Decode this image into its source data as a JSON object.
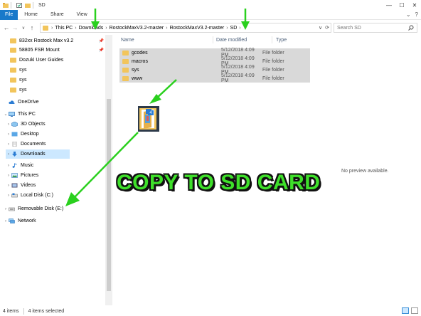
{
  "window": {
    "title": "SD",
    "controls": {
      "minimize": "—",
      "maximize": "☐",
      "close": "✕"
    }
  },
  "ribbon": {
    "tabs": [
      "File",
      "Home",
      "Share",
      "View"
    ],
    "help": "?"
  },
  "nav_buttons": {
    "back": "←",
    "forward": "→",
    "recent": "∨",
    "up": "↑"
  },
  "address": {
    "crumbs": [
      "This PC",
      "Downloads",
      "RostockMaxV3.2-master",
      "RostockMaxV3.2-master",
      "SD"
    ],
    "separator": "›",
    "dropdown": "∨",
    "refresh": "⟳"
  },
  "search": {
    "placeholder": "Search SD",
    "icon": "search-icon"
  },
  "nav_pane": {
    "quick_access": [
      {
        "label": "832xx Rostock Max v3.2",
        "pinned": true
      },
      {
        "label": "58805 FSR Mount",
        "pinned": true
      },
      {
        "label": "Dozuki User Guides",
        "pinned": false
      },
      {
        "label": "sys",
        "pinned": false
      },
      {
        "label": "sys",
        "pinned": false
      },
      {
        "label": "sys",
        "pinned": false
      }
    ],
    "onedrive": "OneDrive",
    "this_pc": "This PC",
    "pc_items": [
      "3D Objects",
      "Desktop",
      "Documents",
      "Downloads",
      "Music",
      "Pictures",
      "Videos",
      "Local Disk (C:)"
    ],
    "removable": "Removable Disk (E:)",
    "network": "Network",
    "selected": "Downloads"
  },
  "file_list": {
    "columns": [
      "Name",
      "Date modified",
      "Type"
    ],
    "rows": [
      {
        "name": "gcodes",
        "date": "5/12/2018 4:09 PM",
        "type": "File folder"
      },
      {
        "name": "macros",
        "date": "5/12/2018 4:09 PM",
        "type": "File folder"
      },
      {
        "name": "sys",
        "date": "5/12/2018 4:09 PM",
        "type": "File folder"
      },
      {
        "name": "www",
        "date": "5/12/2018 4:09 PM",
        "type": "File folder"
      }
    ]
  },
  "drag": {
    "count_badge": "4"
  },
  "preview": {
    "text": "No preview available."
  },
  "annotation": {
    "banner": "COPY TO SD CARD",
    "color": "#3ee02a"
  },
  "status": {
    "items": "4 items",
    "selected": "4 items selected"
  },
  "colors": {
    "file_tab": "#1979ca",
    "selection": "#cce8ff",
    "row_highlight": "#d9d9d9",
    "folder": "#f2c55c"
  }
}
